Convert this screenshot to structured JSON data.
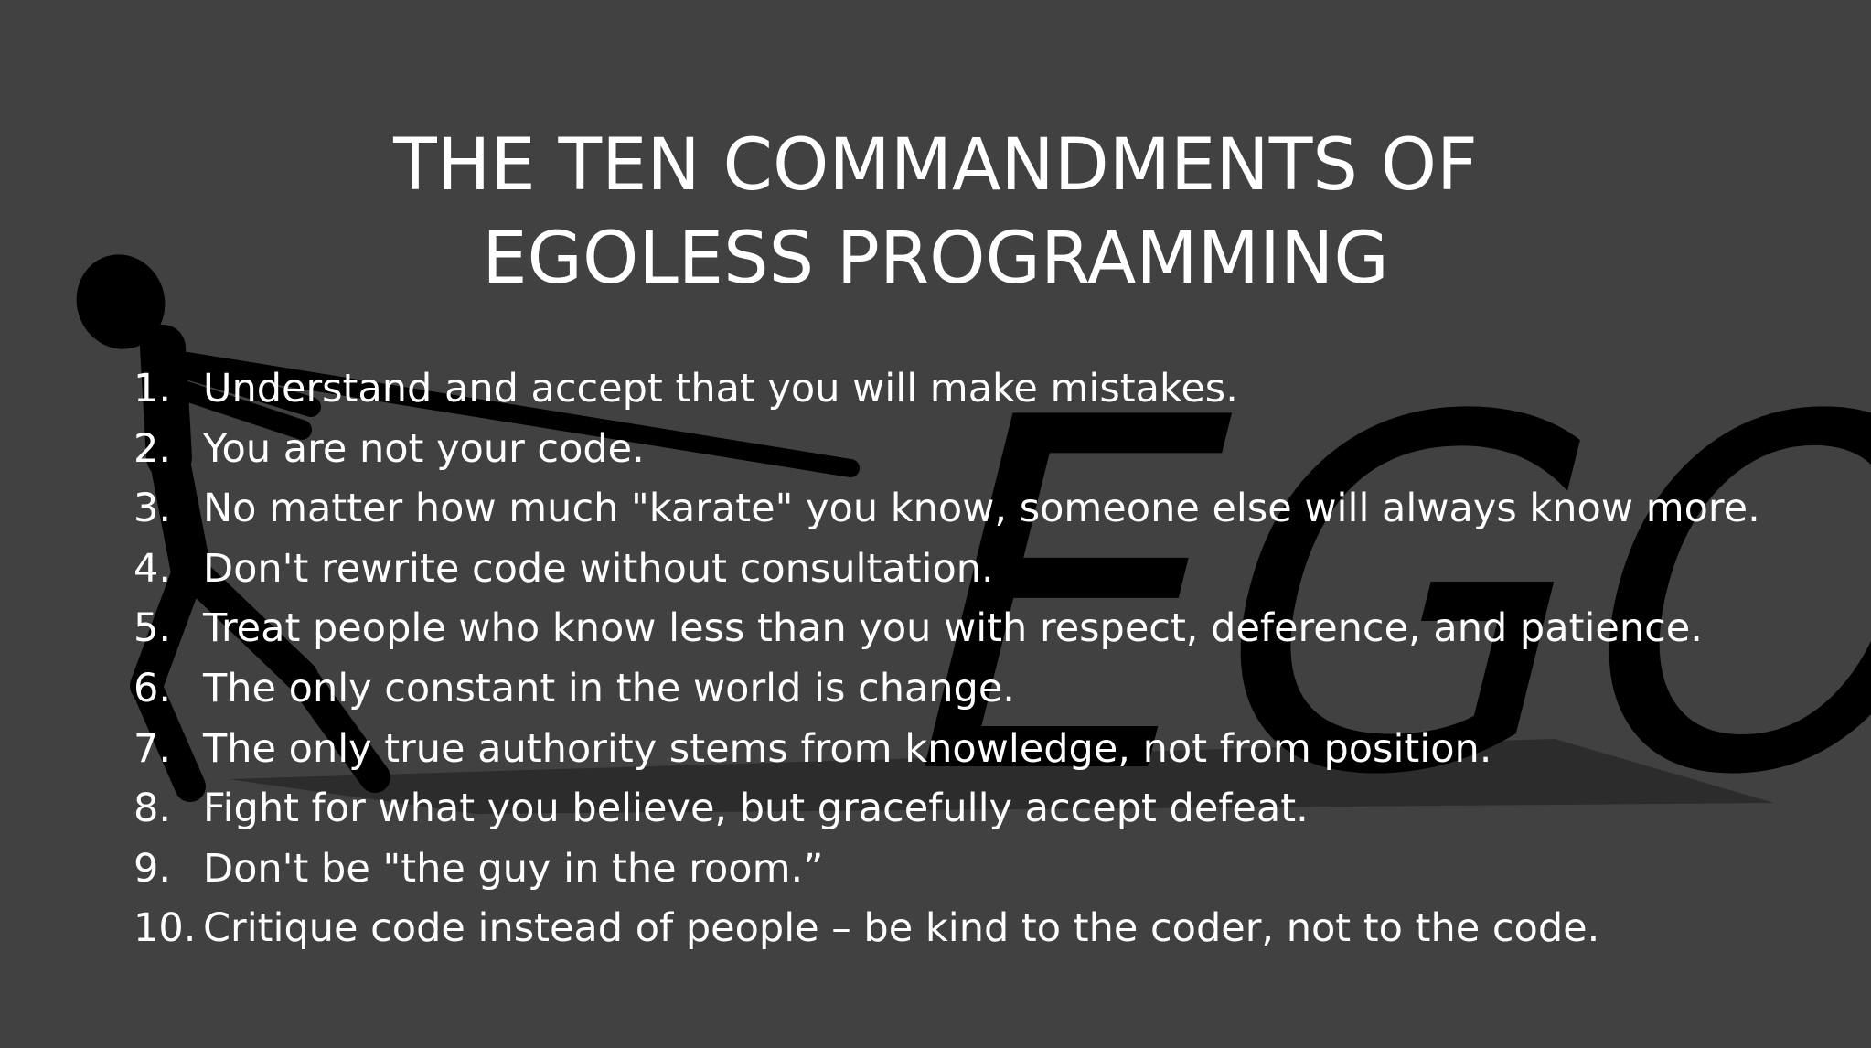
{
  "slide": {
    "background_color": "#414141",
    "text_color": "#ffffff",
    "title_line_1": "THE TEN COMMANDMENTS OF",
    "title_line_2": "EGOLESS PROGRAMMING",
    "commandments": [
      {
        "number": "1.",
        "text": "Understand and accept that you will make mistakes."
      },
      {
        "number": "2.",
        "text": "You are not your code."
      },
      {
        "number": "3.",
        "text": "No matter how much \"karate\" you know, someone else will always know more."
      },
      {
        "number": "4.",
        "text": "Don't rewrite code without consultation."
      },
      {
        "number": "5.",
        "text": "Treat people who know less than you with respect, deference, and patience."
      },
      {
        "number": "6.",
        "text": "The only constant in the world is change."
      },
      {
        "number": "7.",
        "text": "The only true authority stems from knowledge, not from position."
      },
      {
        "number": "8.",
        "text": "Fight for what you believe, but gracefully accept defeat."
      },
      {
        "number": "9.",
        "text": "Don't be \"the guy in the room.”"
      },
      {
        "number": "10.",
        "text": "Critique code instead of people – be kind to the coder, not to the code."
      }
    ]
  },
  "illustration": {
    "word": "EGO",
    "figure": "stick-figure-pulling-rope-icon",
    "color": "#000000"
  }
}
